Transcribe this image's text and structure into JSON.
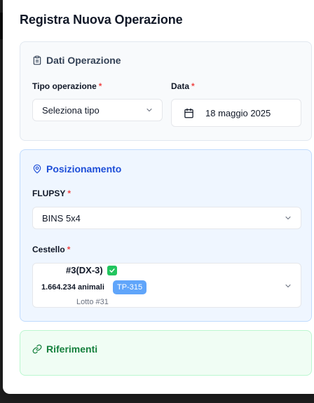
{
  "dialog": {
    "title": "Registra Nuova Operazione"
  },
  "dati": {
    "heading": "Dati Operazione",
    "icon": "clipboard-icon",
    "tipo_label": "Tipo operazione",
    "tipo_value": "Seleziona tipo",
    "data_label": "Data",
    "data_value": "18 maggio 2025",
    "required_mark": "*"
  },
  "posizionamento": {
    "heading": "Posizionamento",
    "icon": "map-pin-icon",
    "flupsy_label": "FLUPSY",
    "flupsy_value": "BINS 5x4",
    "cestello_label": "Cestello",
    "cestello": {
      "name": "#3(DX-3)",
      "status_icon": "check-icon",
      "animali": "1.664.234 animali",
      "tag": "TP-315",
      "lotto": "Lotto #31"
    }
  },
  "riferimenti": {
    "heading": "Riferimenti",
    "icon": "link-icon"
  },
  "colors": {
    "accent_blue": "#1d4ed8",
    "accent_green": "#15803d",
    "required_red": "#ef4444",
    "badge_blue": "#60a5fa",
    "check_green": "#22c55e"
  }
}
